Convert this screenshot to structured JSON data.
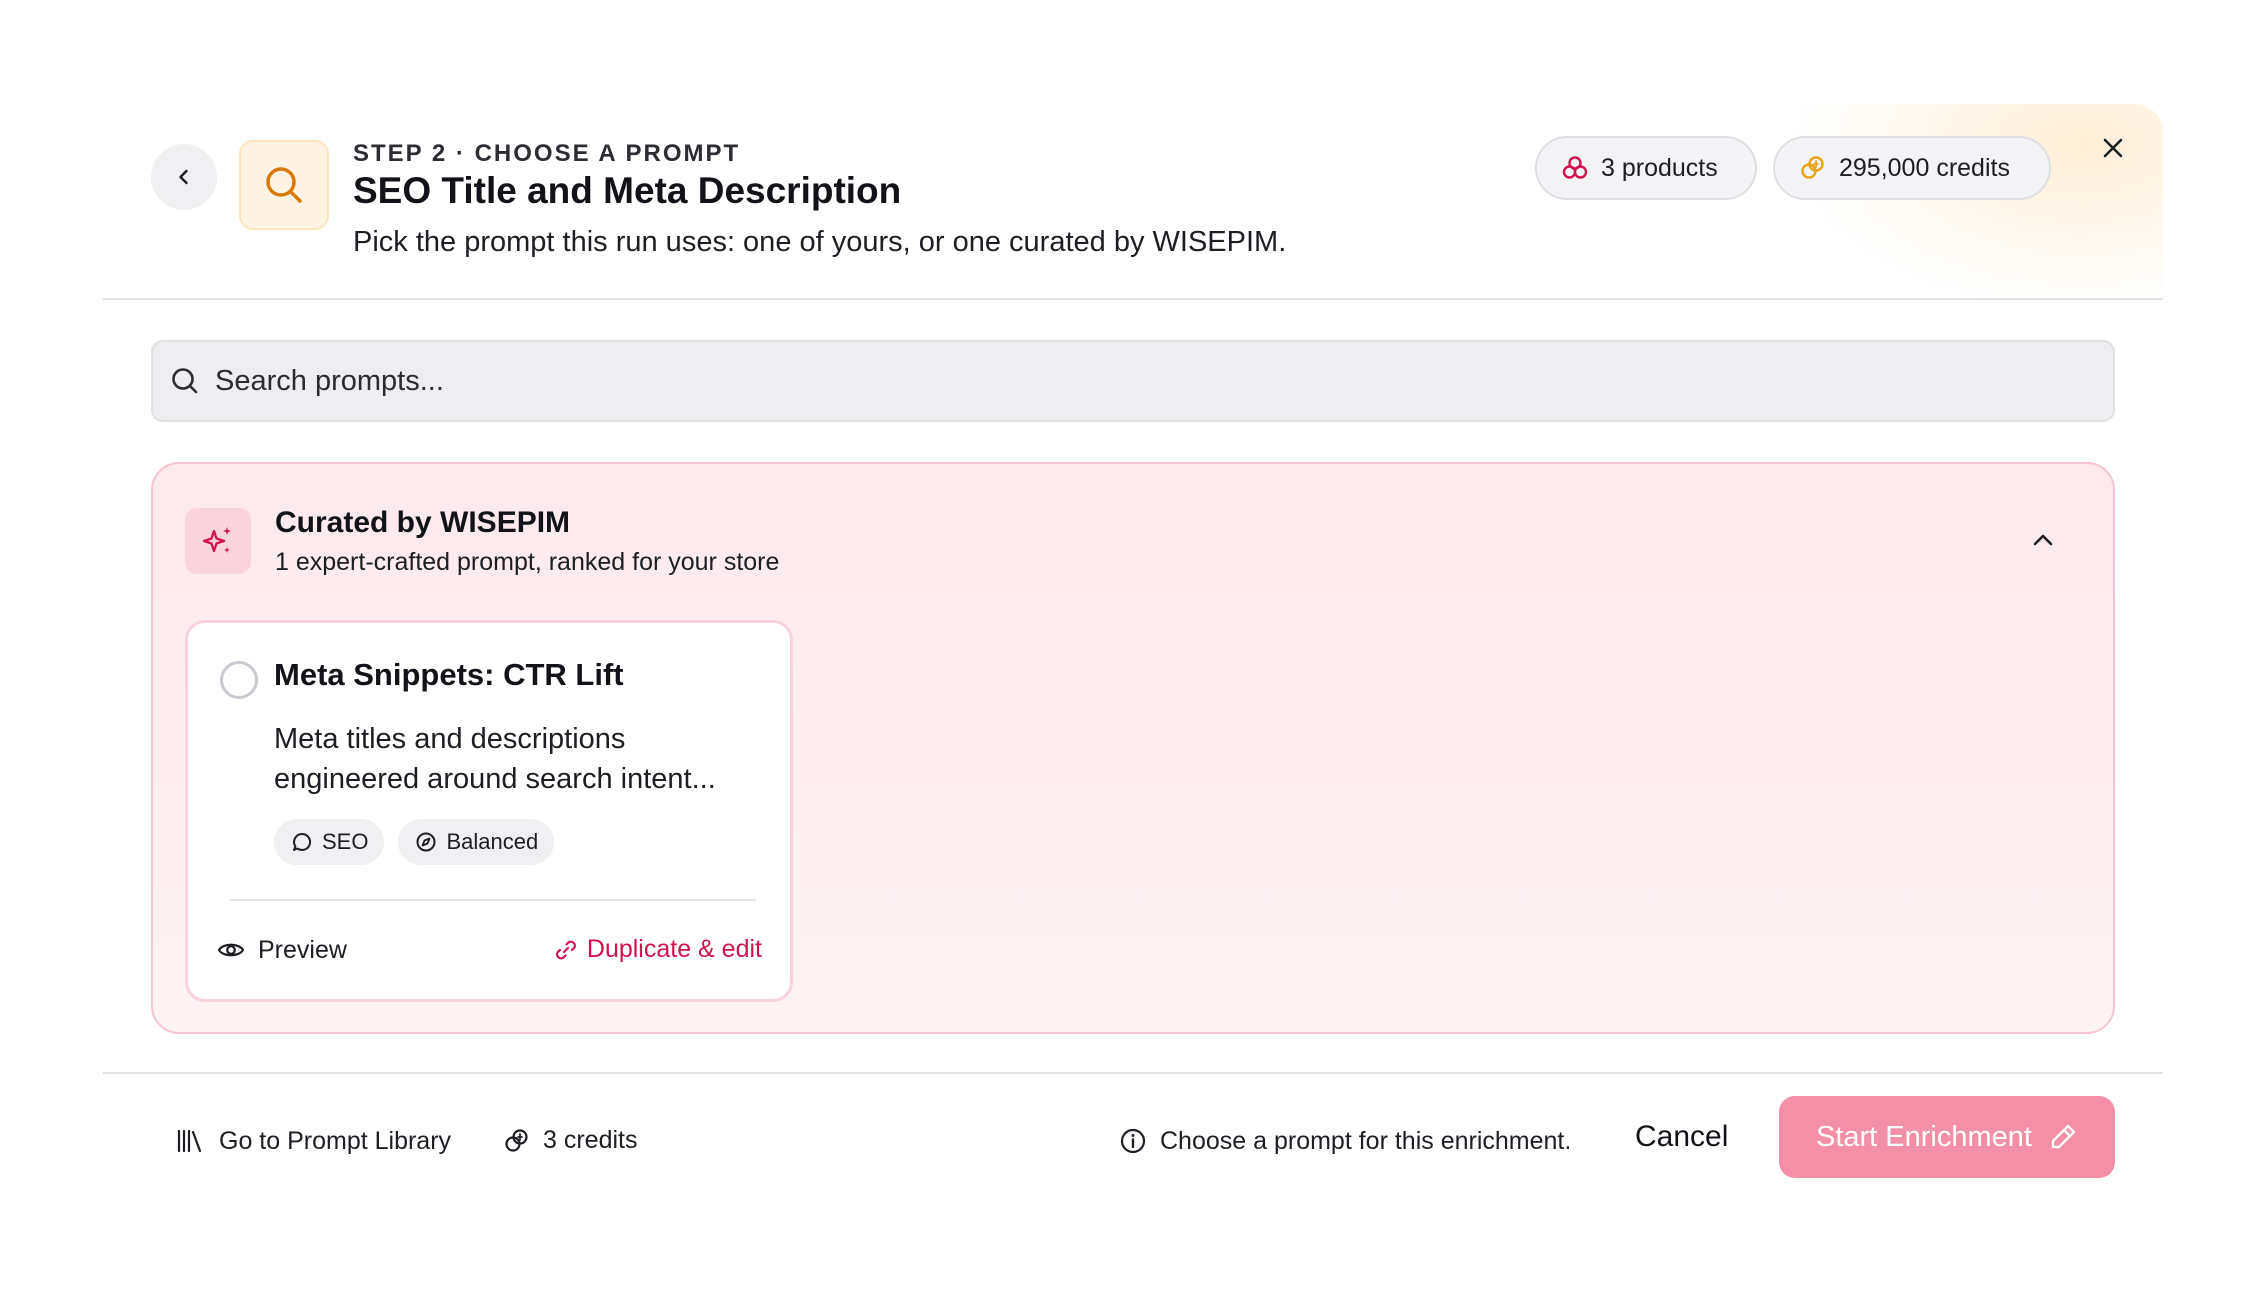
{
  "header": {
    "eyebrow": "STEP 2 · CHOOSE A PROMPT",
    "title": "SEO Title and Meta Description",
    "subtitle": "Pick the prompt this run uses: one of yours, or one curated by WISEPIM.",
    "products_pill": "3 products",
    "credits_pill": "295,000 credits"
  },
  "search": {
    "placeholder": "Search prompts..."
  },
  "curated": {
    "title": "Curated by WISEPIM",
    "subtitle": "1 expert-crafted prompt, ranked for your store",
    "cards": [
      {
        "title": "Meta Snippets: CTR Lift",
        "description": "Meta titles and descriptions engineered around search intent...",
        "tags": [
          "SEO",
          "Balanced"
        ],
        "preview_label": "Preview",
        "duplicate_label": "Duplicate & edit",
        "selected": false
      }
    ]
  },
  "footer": {
    "library_link": "Go to Prompt Library",
    "credits": "3 credits",
    "hint": "Choose a prompt for this enrichment.",
    "cancel_label": "Cancel",
    "start_label": "Start Enrichment"
  },
  "colors": {
    "accent": "#d0134d",
    "start_button": "#f48fa8",
    "step_icon": "#d97a06",
    "curated_bg": "#fde9ee"
  }
}
